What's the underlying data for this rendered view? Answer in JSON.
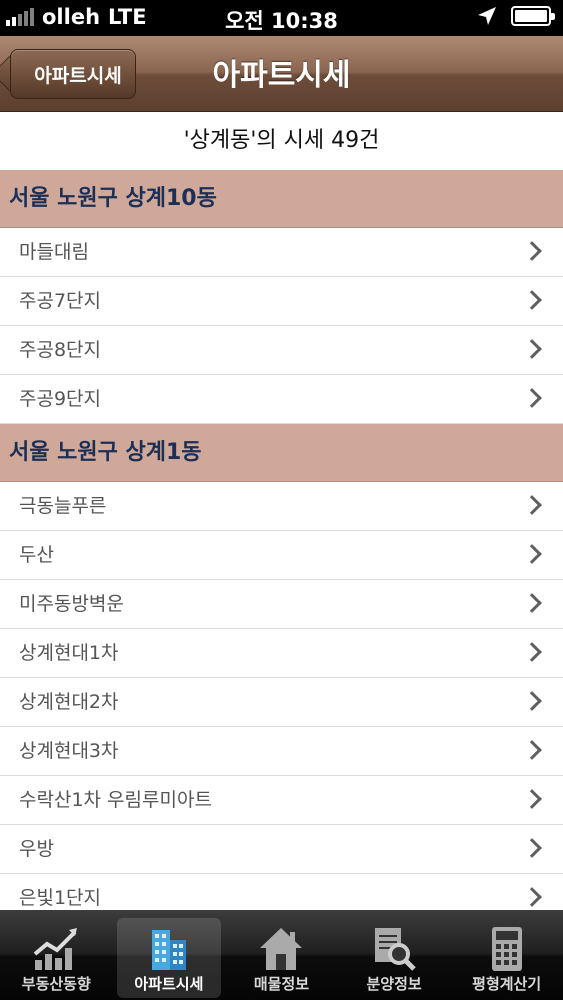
{
  "status_bar": {
    "carrier": "olleh",
    "network": "LTE",
    "time": "오전 10:38"
  },
  "nav": {
    "back_label": "아파트시세",
    "title": "아파트시세"
  },
  "result_count": "'상계동'의 시세 49건",
  "sections": [
    {
      "header": "서울 노원구 상계10동",
      "items": [
        "마들대림",
        "주공7단지",
        "주공8단지",
        "주공9단지"
      ]
    },
    {
      "header": "서울 노원구 상계1동",
      "items": [
        "극동늘푸른",
        "두산",
        "미주동방벽운",
        "상계현대1차",
        "상계현대2차",
        "상계현대3차",
        "수락산1차 우림루미아트",
        "우방",
        "은빛1단지"
      ]
    }
  ],
  "tabbar": {
    "tabs": [
      {
        "label": "부동산동향",
        "icon": "chart-icon"
      },
      {
        "label": "아파트시세",
        "icon": "building-icon",
        "active": true
      },
      {
        "label": "매물정보",
        "icon": "house-icon"
      },
      {
        "label": "분양정보",
        "icon": "document-search-icon"
      },
      {
        "label": "평형계산기",
        "icon": "calculator-icon"
      }
    ]
  },
  "colors": {
    "section_header_bg": "#cfa899",
    "section_header_text": "#1c2f57",
    "nav_bar": "#7a5844"
  }
}
